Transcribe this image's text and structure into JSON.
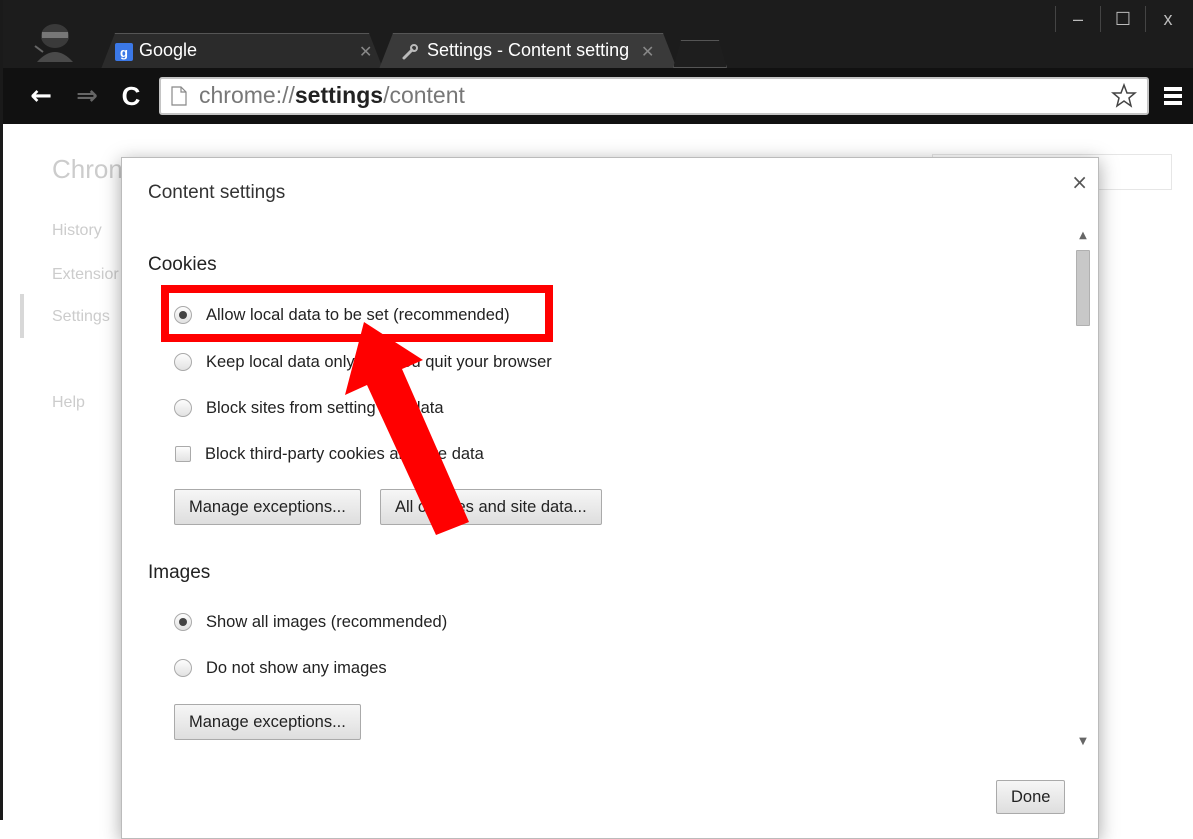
{
  "browser": {
    "tabs": [
      {
        "title": "Google",
        "icon": "google-favicon-icon"
      },
      {
        "title": "Settings - Content settings",
        "icon": "wrench-icon"
      }
    ],
    "window_controls": {
      "minimize": "–",
      "maximize": "☐",
      "close": "x"
    },
    "nav": {
      "back": "←",
      "forward": "⇒",
      "reload": "C"
    },
    "url": {
      "prefix": "chrome://",
      "bold": "settings",
      "suffix": "/content"
    }
  },
  "background_page": {
    "title": "Chron",
    "nav": [
      "History",
      "Extensior",
      "Settings",
      "Help"
    ]
  },
  "dialog": {
    "title": "Content settings",
    "close": "×",
    "cookies": {
      "title": "Cookies",
      "options": [
        {
          "label": "Allow local data to be set (recommended)",
          "type": "radio",
          "checked": true
        },
        {
          "label": "Keep local data only until you quit your browser",
          "type": "radio",
          "checked": false
        },
        {
          "label": "Block sites from setting any data",
          "type": "radio",
          "checked": false
        },
        {
          "label": "Block third-party cookies and site data",
          "type": "checkbox",
          "checked": false
        }
      ],
      "buttons": [
        "Manage exceptions...",
        "All cookies and site data..."
      ]
    },
    "images": {
      "title": "Images",
      "options": [
        {
          "label": "Show all images (recommended)",
          "type": "radio",
          "checked": true
        },
        {
          "label": "Do not show any images",
          "type": "radio",
          "checked": false
        }
      ],
      "buttons": [
        "Manage exceptions..."
      ]
    },
    "done": "Done"
  },
  "annotation_color": "#ff0000"
}
